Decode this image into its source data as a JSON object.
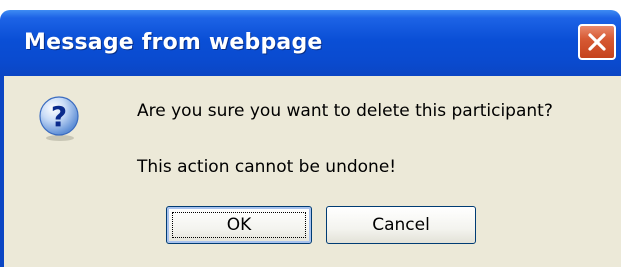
{
  "window": {
    "title": "Message from webpage"
  },
  "message": {
    "line1": "Are you sure you want to delete this participant?",
    "line2": "This action cannot be undone!"
  },
  "buttons": {
    "ok_label": "OK",
    "cancel_label": "Cancel"
  },
  "icons": {
    "dialog_icon": "question-icon",
    "close": "close-icon"
  },
  "colors": {
    "titlebar": "#0a4fd6",
    "close_button": "#d75a34",
    "dialog_background": "#ece9d8"
  }
}
